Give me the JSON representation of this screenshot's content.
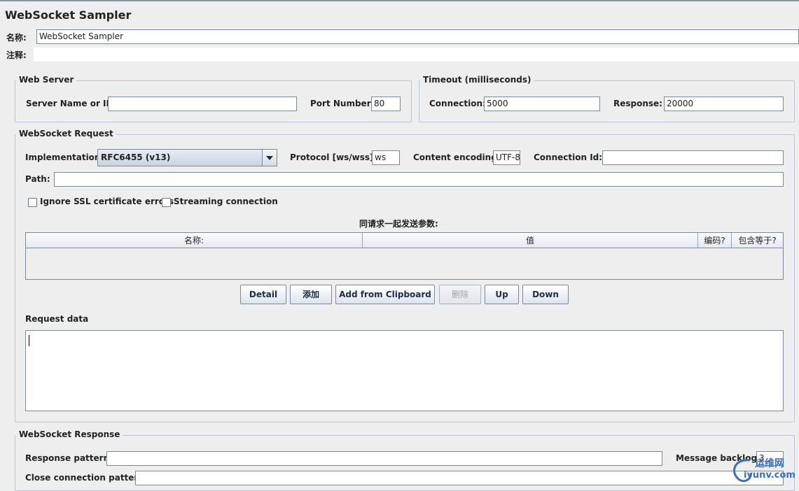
{
  "window": {
    "title": "WebSocket Sampler"
  },
  "name_row": {
    "label": "名称:",
    "value": "WebSocket Sampler"
  },
  "comment_row": {
    "label": "注释:",
    "value": ""
  },
  "web_server": {
    "legend": "Web Server",
    "server_label": "Server Name or IP:",
    "server_value": "",
    "port_label": "Port Number:",
    "port_value": "80"
  },
  "timeout": {
    "legend": "Timeout (milliseconds)",
    "connection_label": "Connection:",
    "connection_value": "5000",
    "response_label": "Response:",
    "response_value": "20000"
  },
  "request": {
    "legend": "WebSocket Request",
    "implementation_label": "Implementation:",
    "implementation_value": "RFC6455 (v13)",
    "protocol_label": "Protocol [ws/wss]:",
    "protocol_value": "ws",
    "encoding_label": "Content encoding:",
    "encoding_value": "UTF-8",
    "connid_label": "Connection Id:",
    "connid_value": "",
    "path_label": "Path:",
    "path_value": "",
    "ignore_ssl_label": "Ignore SSL certificate errors",
    "streaming_label": "Streaming connection",
    "params_title": "同请求一起发送参数:",
    "params_columns": [
      "名称:",
      "值",
      "编码?",
      "包含等于?"
    ],
    "buttons": {
      "detail": "Detail",
      "add": "添加",
      "clipboard": "Add from Clipboard",
      "delete": "删除",
      "up": "Up",
      "down": "Down"
    },
    "request_data_label": "Request data",
    "request_data_value": ""
  },
  "response": {
    "legend": "WebSocket Response",
    "pattern_label": "Response pattern:",
    "pattern_value": "",
    "backlog_label": "Message backlog:",
    "backlog_value": "3",
    "close_label": "Close connection pattern:",
    "close_value": ""
  },
  "watermark": {
    "cn": "运维网",
    "url": "iyunv.com"
  }
}
